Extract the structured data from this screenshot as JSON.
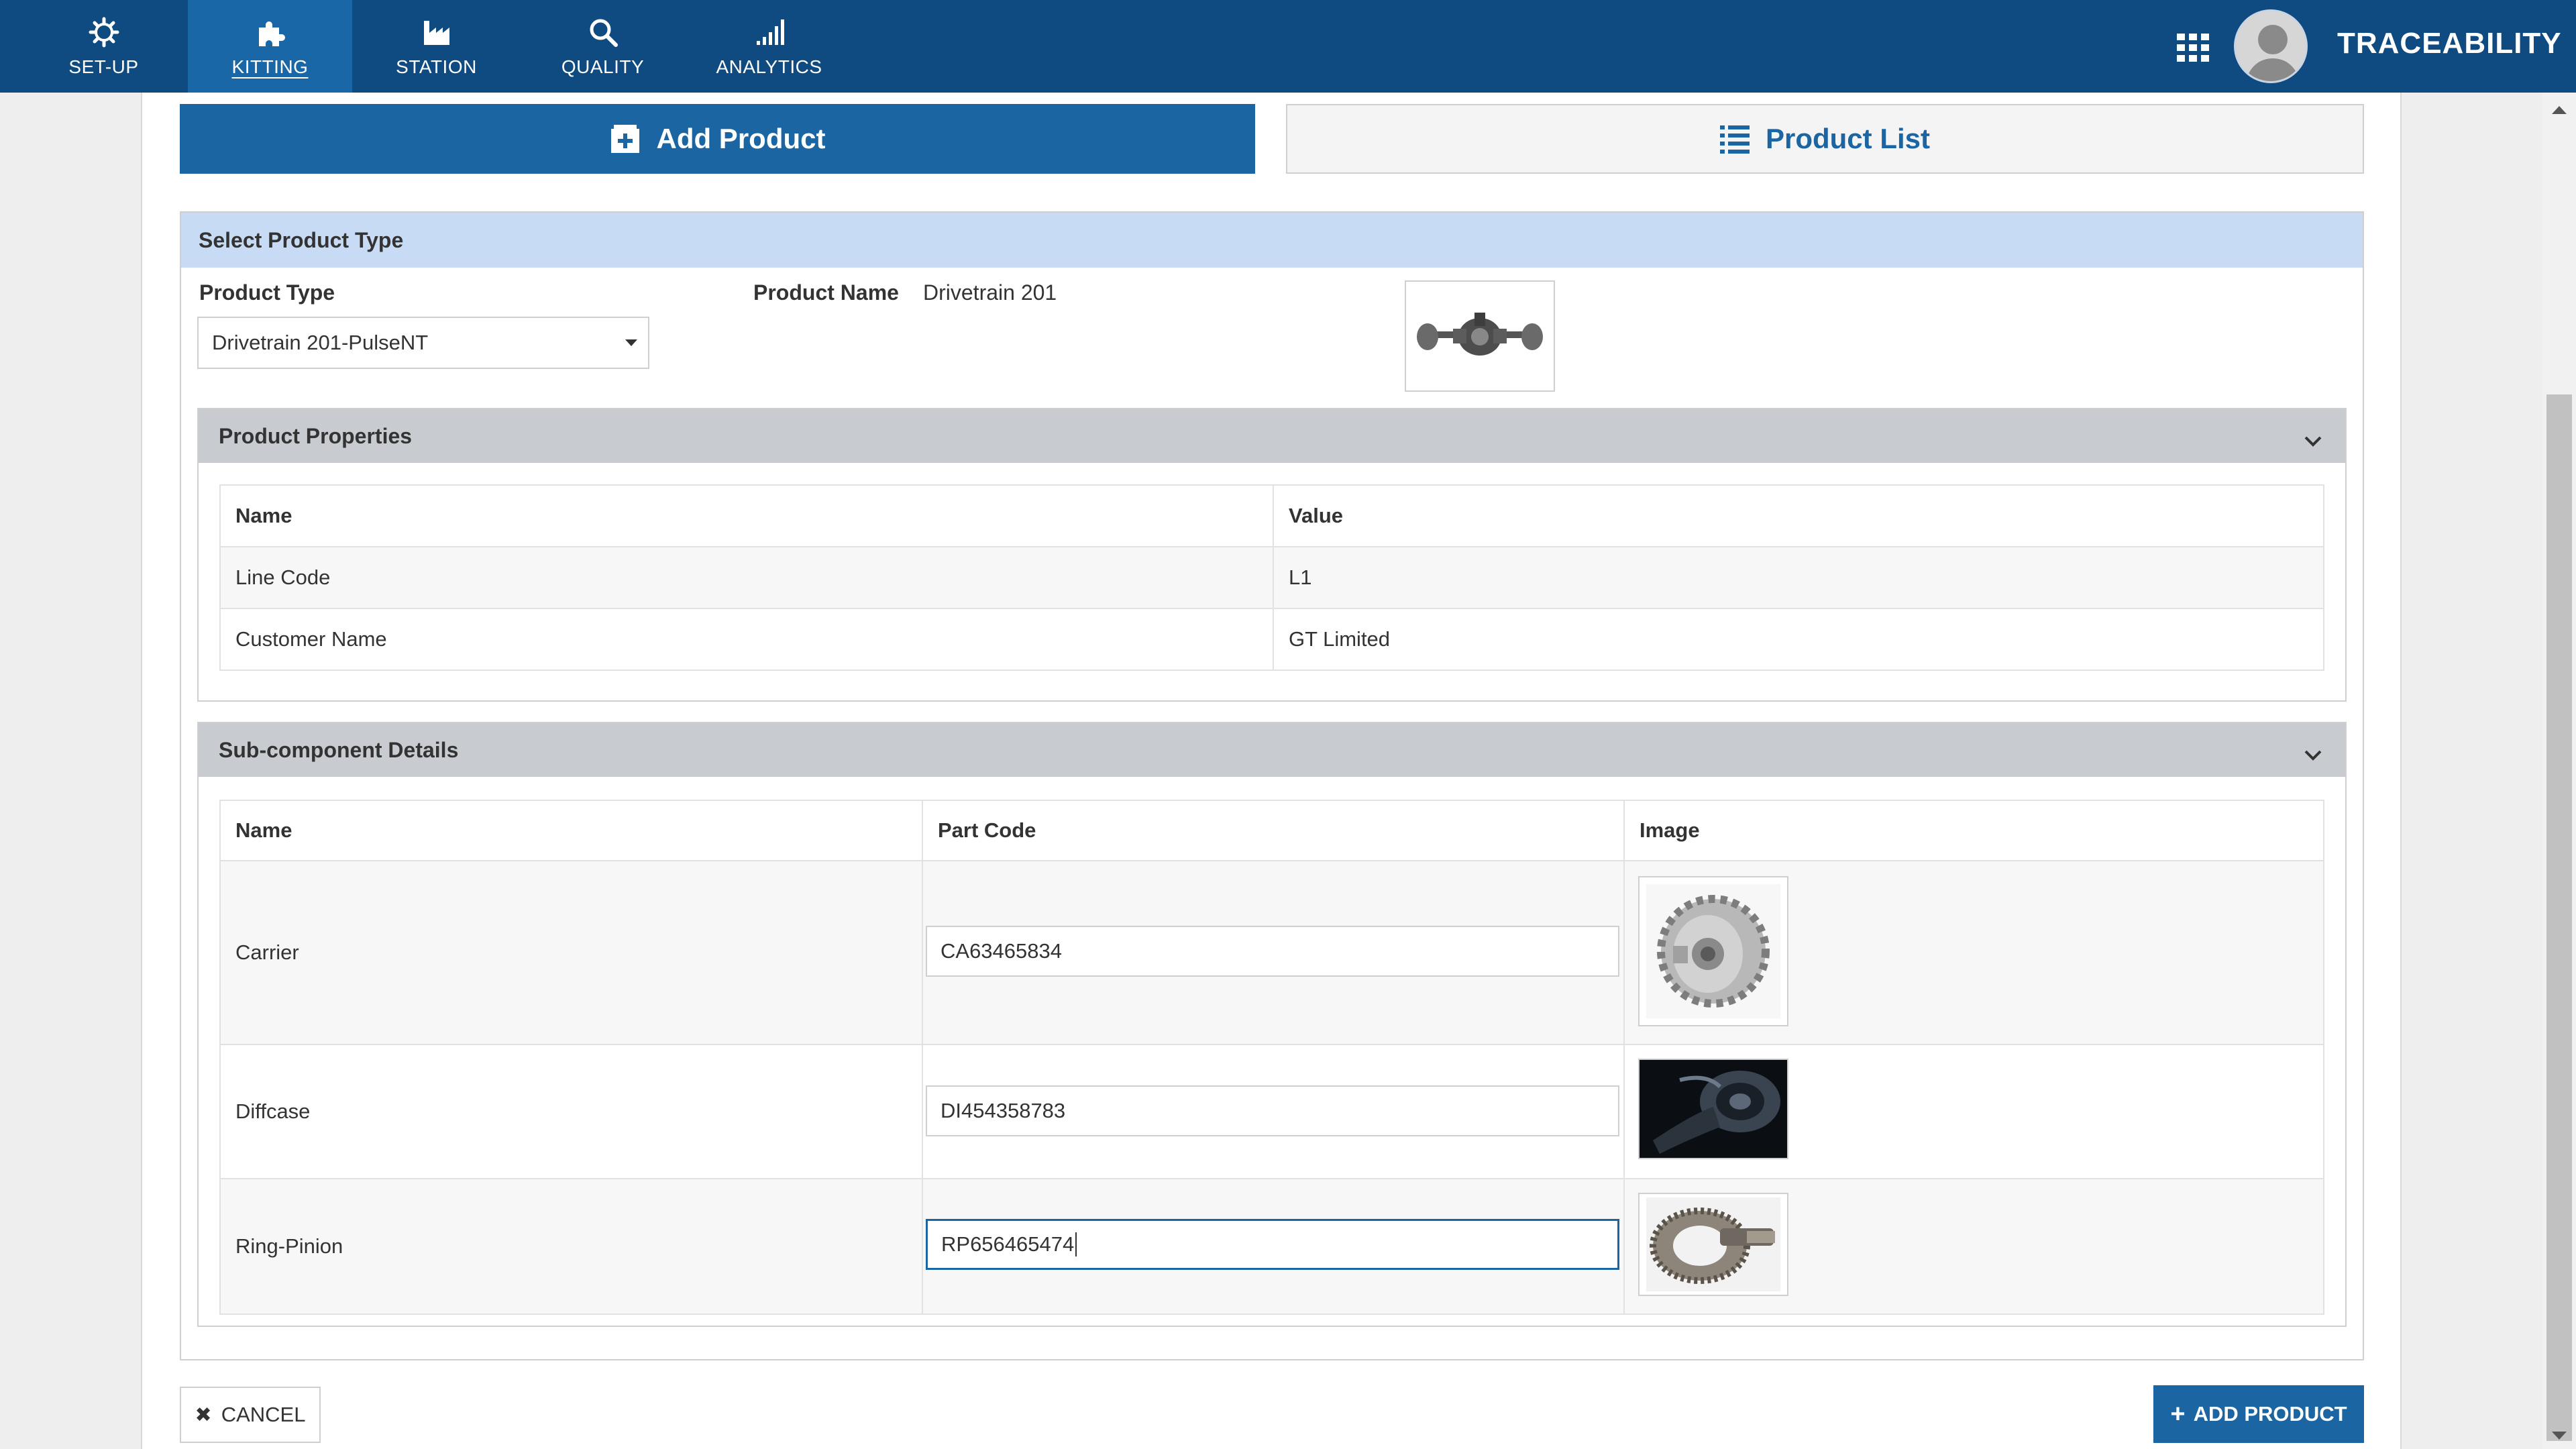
{
  "nav": {
    "items": [
      {
        "label": "SET-UP",
        "icon": "gear-icon"
      },
      {
        "label": "KITTING",
        "icon": "puzzle-icon",
        "active": true
      },
      {
        "label": "STATION",
        "icon": "factory-icon"
      },
      {
        "label": "QUALITY",
        "icon": "search-icon"
      },
      {
        "label": "ANALYTICS",
        "icon": "signal-bars-icon"
      }
    ],
    "brand": "TRACEABILITY",
    "apps_icon": "grid-icon",
    "avatar_icon": "user-avatar-icon"
  },
  "tabs": {
    "add_label": "Add Product",
    "list_label": "Product List"
  },
  "form": {
    "header": "Select Product Type",
    "product_type_label": "Product Type",
    "product_type_value": "Drivetrain 201-PulseNT",
    "product_name_label": "Product Name",
    "product_name_value": "Drivetrain 201"
  },
  "properties": {
    "title": "Product Properties",
    "col_name": "Name",
    "col_value": "Value",
    "rows": [
      {
        "name": "Line Code",
        "value": "L1"
      },
      {
        "name": "Customer Name",
        "value": "GT Limited"
      }
    ]
  },
  "subcomponents": {
    "title": "Sub-component Details",
    "col_name": "Name",
    "col_part": "Part Code",
    "col_image": "Image",
    "rows": [
      {
        "name": "Carrier",
        "part_code": "CA63465834",
        "image": "carrier-image"
      },
      {
        "name": "Diffcase",
        "part_code": "DI454358783",
        "image": "diffcase-image"
      },
      {
        "name": "Ring-Pinion",
        "part_code": "RP656465474",
        "image": "ring-pinion-image"
      }
    ]
  },
  "actions": {
    "cancel_label": "CANCEL",
    "add_label": "ADD PRODUCT"
  },
  "colors": {
    "nav_bg": "#0f4a80",
    "nav_active": "#1a67a8",
    "primary": "#1c65a3",
    "panel_header": "#c8dbf5",
    "section_header": "#c8ccd0"
  }
}
